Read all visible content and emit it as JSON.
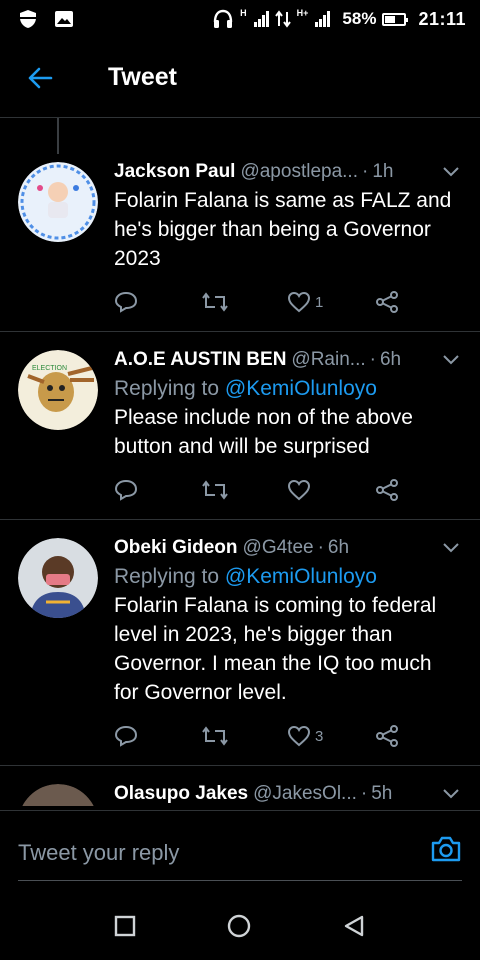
{
  "status_bar": {
    "network_1": "H",
    "network_2": "H+",
    "battery": "58%",
    "battery_level": 0.58,
    "time": "21:11"
  },
  "header": {
    "title": "Tweet"
  },
  "tweets": [
    {
      "name": "Jackson Paul",
      "handle": "@apostlepa...",
      "time": "1h",
      "replying_prefix": "",
      "replying_mention": "",
      "text_lines": [
        "Folarin Falana is same as FALZ and",
        "he's bigger than being a Governor",
        "2023"
      ],
      "likes": "1"
    },
    {
      "name": "A.O.E AUSTIN BEN",
      "handle": "@Rain...",
      "time": "6h",
      "replying_prefix": "Replying to ",
      "replying_mention": "@KemiOlunloyo",
      "text_lines": [
        "Please include non of the above",
        "button and will be surprised"
      ],
      "likes": ""
    },
    {
      "name": "Obeki Gideon",
      "handle": "@G4tee",
      "time": "6h",
      "replying_prefix": "Replying to ",
      "replying_mention": "@KemiOlunloyo",
      "text_lines": [
        "Folarin Falana is coming to federal",
        "level in 2023, he's bigger than",
        "Governor. I mean the IQ too much",
        "for Governor level."
      ],
      "likes": "3"
    },
    {
      "name": "Olasupo Jakes",
      "handle": "@JakesOl...",
      "time": "5h"
    }
  ],
  "reply_bar": {
    "placeholder": "Tweet your reply"
  },
  "colors": {
    "accent": "#1d9bf0",
    "muted": "#8b98a5",
    "divider": "#2f3336",
    "background": "#000000"
  }
}
